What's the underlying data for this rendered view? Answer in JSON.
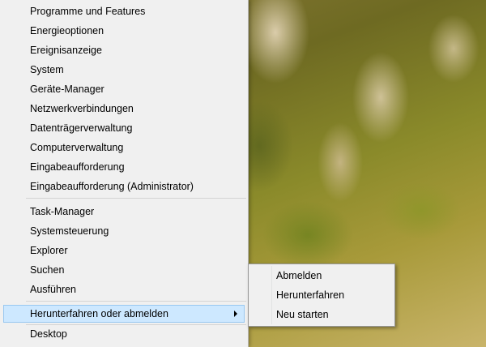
{
  "main_menu": {
    "items": [
      {
        "label": "Programme und Features",
        "name": "menu-item-programme-und-features"
      },
      {
        "label": "Energieoptionen",
        "name": "menu-item-energieoptionen"
      },
      {
        "label": "Ereignisanzeige",
        "name": "menu-item-ereignisanzeige"
      },
      {
        "label": "System",
        "name": "menu-item-system"
      },
      {
        "label": "Geräte-Manager",
        "name": "menu-item-geraete-manager"
      },
      {
        "label": "Netzwerkverbindungen",
        "name": "menu-item-netzwerkverbindungen"
      },
      {
        "label": "Datenträgerverwaltung",
        "name": "menu-item-datentraegerverwaltung"
      },
      {
        "label": "Computerverwaltung",
        "name": "menu-item-computerverwaltung"
      },
      {
        "label": "Eingabeaufforderung",
        "name": "menu-item-eingabeaufforderung"
      },
      {
        "label": "Eingabeaufforderung (Administrator)",
        "name": "menu-item-eingabeaufforderung-admin"
      },
      {
        "label": "Task-Manager",
        "name": "menu-item-task-manager"
      },
      {
        "label": "Systemsteuerung",
        "name": "menu-item-systemsteuerung"
      },
      {
        "label": "Explorer",
        "name": "menu-item-explorer"
      },
      {
        "label": "Suchen",
        "name": "menu-item-suchen"
      },
      {
        "label": "Ausführen",
        "name": "menu-item-ausfuehren"
      },
      {
        "label": "Herunterfahren oder abmelden",
        "name": "menu-item-herunterfahren-oder-abmelden"
      },
      {
        "label": "Desktop",
        "name": "menu-item-desktop"
      }
    ]
  },
  "sub_menu": {
    "items": [
      {
        "label": "Abmelden"
      },
      {
        "label": "Herunterfahren"
      },
      {
        "label": "Neu starten"
      }
    ]
  },
  "colors": {
    "menu_background": "#f0f0f0",
    "highlight_background": "#cde8ff",
    "highlight_border": "#99c8f0"
  },
  "icons": {
    "submenu_arrow": "chevron-right-icon"
  }
}
